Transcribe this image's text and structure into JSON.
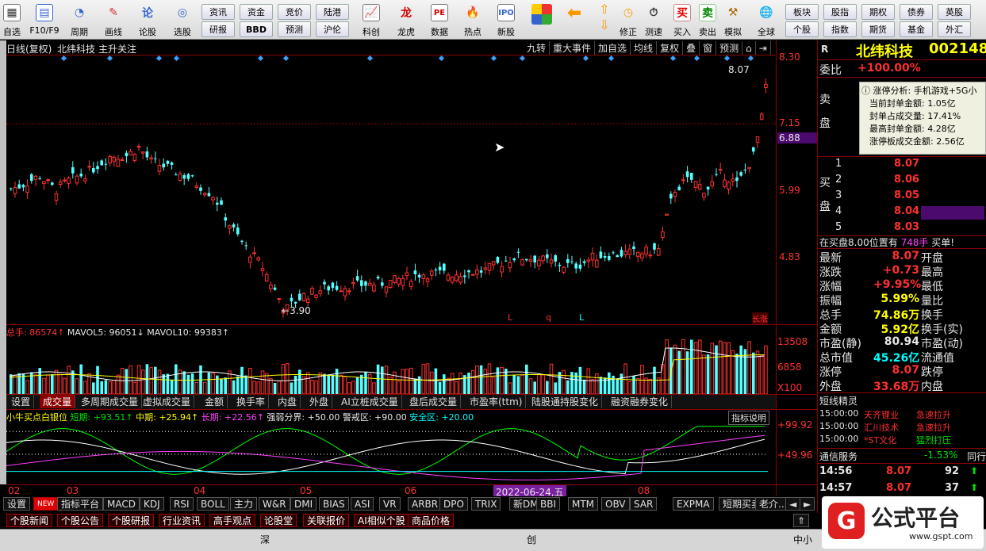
{
  "toolbar": {
    "big_buttons": [
      {
        "label": "自选",
        "icon": "grid-icon"
      },
      {
        "label": "F10/F9",
        "icon": "table-icon"
      },
      {
        "label": "周期",
        "icon": "cycle-icon"
      },
      {
        "label": "画线",
        "icon": "pen-icon"
      },
      {
        "label": "论股",
        "icon": "discuss-icon"
      },
      {
        "label": "选股",
        "icon": "scan-icon"
      }
    ],
    "small_buttons_row1": [
      "资讯",
      "资金",
      "竞价",
      "陆港"
    ],
    "small_buttons_row2": [
      "研报",
      "BBD",
      "预测",
      "沪伦"
    ],
    "mid_buttons": [
      {
        "label": "科创",
        "icon": "chart-icon"
      },
      {
        "label": "龙虎",
        "icon": "dragon-icon"
      },
      {
        "label": "数据",
        "icon": "pe-icon"
      },
      {
        "label": "热点",
        "icon": "fire-icon"
      },
      {
        "label": "新股",
        "icon": "ipo-icon"
      }
    ],
    "right_buttons": [
      {
        "label": "修正",
        "icon": "clock-icon"
      },
      {
        "label": "测速",
        "icon": "speed-icon"
      },
      {
        "label": "买入",
        "icon": "buy-icon",
        "glyph": "买"
      },
      {
        "label": "卖出",
        "icon": "sell-icon",
        "glyph": "卖"
      },
      {
        "label": "模拟",
        "icon": "hammer-icon"
      },
      {
        "label": "全球",
        "icon": "globe-icon"
      }
    ],
    "far_row1": [
      "板块",
      "股指",
      "期权",
      "债券",
      "英股"
    ],
    "far_row2": [
      "个股",
      "指数",
      "期货",
      "基金",
      "外汇"
    ]
  },
  "chart_header": {
    "period": "日线(复权)",
    "stock_name": "北纬科技",
    "tag": "主升关注",
    "tools": [
      "九转",
      "重大事件",
      "加自选",
      "均线",
      "复权",
      "叠",
      "窗",
      "预测"
    ]
  },
  "price_axis": [
    "8.30",
    "7.15",
    "5.99",
    "4.83"
  ],
  "price_highlight": "6.88",
  "annotations": {
    "high": "8.07",
    "low": "3.90",
    "bottom_marks": [
      "L",
      "q",
      "L"
    ],
    "right_mark": "长涨"
  },
  "volume_header": {
    "total": "总手: 86574↑",
    "ma5": "MAVOL5: 96051↓",
    "ma10": "MAVOL10: 99383↑"
  },
  "volume_axis": [
    "13508",
    "6858",
    "X100"
  ],
  "volume_tabs": [
    "设置",
    "成交量",
    "多周期成交量",
    "虚拟成交量",
    "金额",
    "换手率",
    "内盘",
    "外盘",
    "AI立桩成交量",
    "盘后成交量",
    "市盈率(ttm)",
    "陆股通持股变化",
    "融资融券变化"
  ],
  "indicator_header": {
    "name": "小牛买点白银位",
    "short": "短期: +93.51↑",
    "mid": "中期: +25.94↑",
    "long": "长期: +22.56↑",
    "strong": "强弱分界: +50.00",
    "alert": "警戒区: +90.00",
    "safe": "安全区: +20.00",
    "help": "指标说明"
  },
  "indicator_axis": [
    "+99.92",
    "+49.96"
  ],
  "date_axis": [
    "02",
    "03",
    "04",
    "05",
    "06",
    "08"
  ],
  "date_highlight": "2022-06-24,五",
  "bottom_tabs": [
    "设置",
    "NEW",
    "指标平台",
    "MACD",
    "KDJ",
    "RSI",
    "BOLL",
    "主力",
    "W&R",
    "DMI",
    "BIAS",
    "ASI",
    "VR",
    "ARBR",
    "DPO",
    "TRIX",
    "新DMA",
    "BBI",
    "MTM",
    "OBV",
    "SAR",
    "EXPMA",
    "短期买卖",
    "老介..."
  ],
  "news_tabs": [
    "个股新闻",
    "个股公告",
    "个股研报",
    "行业资讯",
    "高手观点",
    "论股堂",
    "关联报价",
    "AI相似个股",
    "商品价格"
  ],
  "status": {
    "market1": "深",
    "market2": "创",
    "market3": "中小"
  },
  "quote": {
    "code_letter": "R",
    "name": "北纬科技",
    "code": "002148",
    "webi_label": "委比",
    "webi": "+100.00%",
    "sell_label": "卖盘",
    "buy_label": "买盘",
    "limit_title": "涨停分析: 手机游戏+5G小",
    "limit_lines": [
      "当前封单金额: 1.05亿",
      "封单占成交量: 17.41%",
      "最高封单金额: 4.28亿",
      "涨停板成交金额: 2.56亿"
    ],
    "bids": [
      {
        "level": "1",
        "price": "8.07"
      },
      {
        "level": "2",
        "price": "8.06"
      },
      {
        "level": "3",
        "price": "8.05"
      },
      {
        "level": "4",
        "price": "8.04"
      },
      {
        "level": "5",
        "price": "8.03"
      }
    ],
    "bid_note": "在买盘8.00位置有",
    "bid_note_qty": "748手",
    "bid_note_end": "买单!",
    "stats": [
      {
        "l": "最新",
        "v": "8.07",
        "r": "开盘"
      },
      {
        "l": "涨跌",
        "v": "+0.73",
        "r": "最高"
      },
      {
        "l": "涨幅",
        "v": "+9.95%",
        "r": "最低"
      },
      {
        "l": "振幅",
        "v": "5.99%",
        "r": "量比"
      },
      {
        "l": "总手",
        "v": "74.86万",
        "r": "换手"
      },
      {
        "l": "金额",
        "v": "5.92亿",
        "r": "换手(实)"
      },
      {
        "l": "市盈(静)",
        "v": "80.94",
        "r": "市盈(动)"
      },
      {
        "l": "总市值",
        "v": "45.26亿",
        "r": "流通值"
      },
      {
        "l": "涨停",
        "v": "8.07",
        "r": "跌停"
      },
      {
        "l": "外盘",
        "v": "33.68万",
        "r": "内盘"
      }
    ],
    "sprite_title": "短线精灵",
    "sprites": [
      {
        "t": "15:00:00",
        "n": "天齐锂业",
        "e": "急速拉升"
      },
      {
        "t": "15:00:00",
        "n": "汇川技术",
        "e": "急速拉升"
      },
      {
        "t": "15:00:00",
        "n": "*ST文化",
        "e": "猛烈打压"
      }
    ],
    "sector": {
      "name": "通信服务",
      "chg": "-1.53%",
      "tail": "同行"
    },
    "ticks": [
      {
        "t": "14:56",
        "p": "8.07",
        "v": "92"
      },
      {
        "t": "14:57",
        "p": "8.07",
        "v": "37"
      }
    ]
  },
  "logo": {
    "text": "公式平台",
    "url": "www.gspt.com"
  },
  "colors": {
    "up": "#ff3030",
    "down": "#54ffff",
    "bg": "#000000",
    "grid": "#8b0000"
  }
}
